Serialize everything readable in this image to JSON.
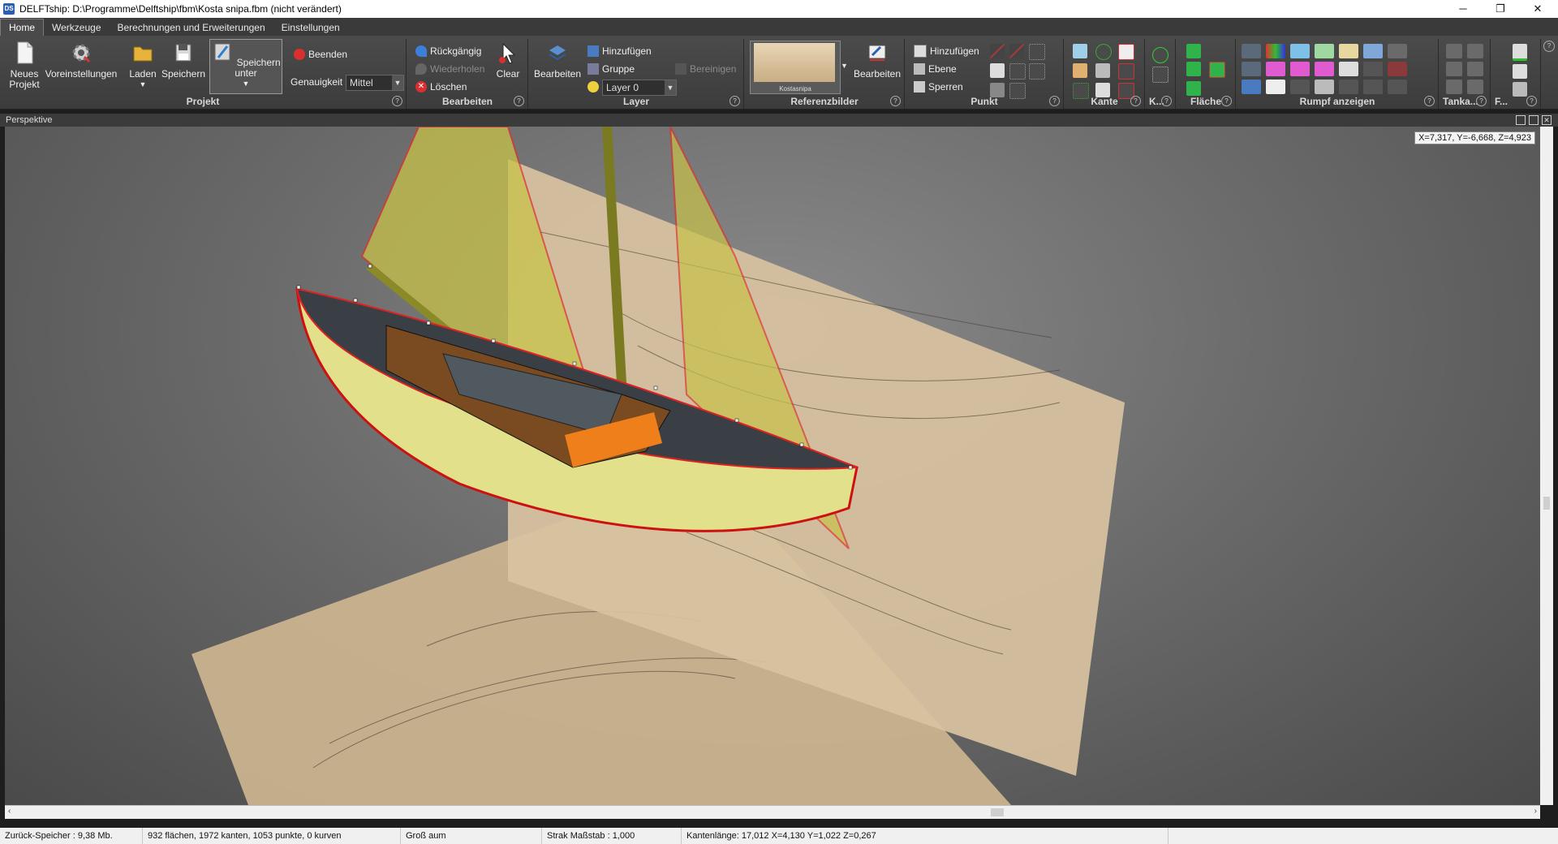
{
  "window": {
    "title": "DELFTship: D:\\Programme\\Delftship\\fbm\\Kosta snipa.fbm (nicht verändert)",
    "minimize": "─",
    "restore": "❐",
    "close": "✕"
  },
  "menu": {
    "tabs": [
      "Home",
      "Werkzeuge",
      "Berechnungen und Erweiterungen",
      "Einstellungen"
    ]
  },
  "ribbon": {
    "projekt": {
      "label": "Projekt",
      "neues_projekt": "Neues Projekt",
      "voreinstellungen": "Voreinstellungen",
      "laden": "Laden",
      "speichern": "Speichern",
      "speichern_unter": "Speichern unter",
      "beenden": "Beenden",
      "genauigkeit": "Genauigkeit",
      "genauigkeit_value": "Mittel"
    },
    "bearbeiten": {
      "label": "Bearbeiten",
      "rueckgaengig": "Rückgängig",
      "wiederholen": "Wiederholen",
      "loeschen": "Löschen",
      "clear": "Clear"
    },
    "layer": {
      "label": "Layer",
      "bearbeiten": "Bearbeiten",
      "hinzufuegen": "Hinzufügen",
      "gruppe": "Gruppe",
      "layer_value": "Layer 0",
      "bereinigen": "Bereinigen"
    },
    "referenzbilder": {
      "label": "Referenzbilder",
      "thumbnail_caption": "Kostasnipa",
      "bearbeiten": "Bearbeiten"
    },
    "punkt": {
      "label": "Punkt",
      "hinzufuegen": "Hinzufügen",
      "ebene": "Ebene",
      "sperren": "Sperren"
    },
    "kante": {
      "label": "Kante"
    },
    "k_group": {
      "label": "K..."
    },
    "flaeche": {
      "label": "Fläche"
    },
    "rumpf": {
      "label": "Rumpf anzeigen"
    },
    "tanka": {
      "label": "Tanka..."
    },
    "f_group": {
      "label": "F..."
    },
    "help": "?"
  },
  "viewport": {
    "title": "Perspektive",
    "coords": "X=7,317, Y=-6,668, Z=4,923"
  },
  "status": {
    "speicher": "Zurück-Speicher : 9,38 Mb.",
    "counts": "932 flächen, 1972 kanten, 1053 punkte, 0 kurven",
    "grossbaum": "Groß aum",
    "strak": "Strak Maßstab : 1,000",
    "kante": "Kantenlänge: 17,012 X=4,130 Y=1,022 Z=0,267"
  }
}
